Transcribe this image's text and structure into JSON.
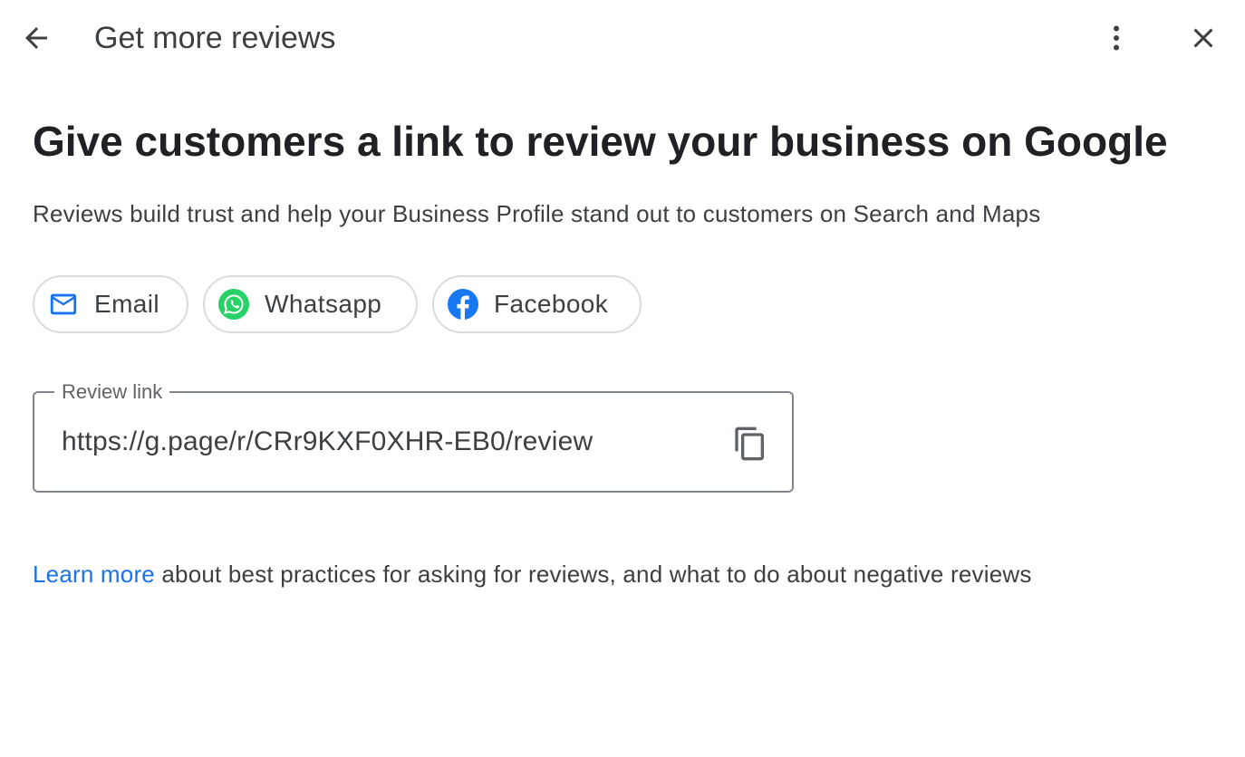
{
  "header": {
    "title": "Get more reviews",
    "back_icon": "arrow-back-icon",
    "more_icon": "more-vert-icon",
    "close_icon": "close-icon"
  },
  "main": {
    "heading": "Give customers a link to review your business on Google",
    "subtitle": "Reviews build trust and help your Business Profile stand out to customers on Search and Maps"
  },
  "share": {
    "chips": [
      {
        "label": "Email",
        "icon": "email-icon",
        "color": "#1a73e8"
      },
      {
        "label": "Whatsapp",
        "icon": "whatsapp-icon",
        "color": "#25d366"
      },
      {
        "label": "Facebook",
        "icon": "facebook-icon",
        "color": "#1877f2"
      }
    ]
  },
  "review_link": {
    "label": "Review link",
    "value": "https://g.page/r/CRr9KXF0XHR-EB0/review",
    "copy_icon": "copy-icon"
  },
  "footer": {
    "link_text": "Learn more",
    "rest_text": " about best practices for asking for reviews, and what to do about negative reviews"
  },
  "colors": {
    "link": "#1a73e8",
    "text": "#202124",
    "secondary_text": "#3c4043",
    "border": "#dadce0"
  }
}
